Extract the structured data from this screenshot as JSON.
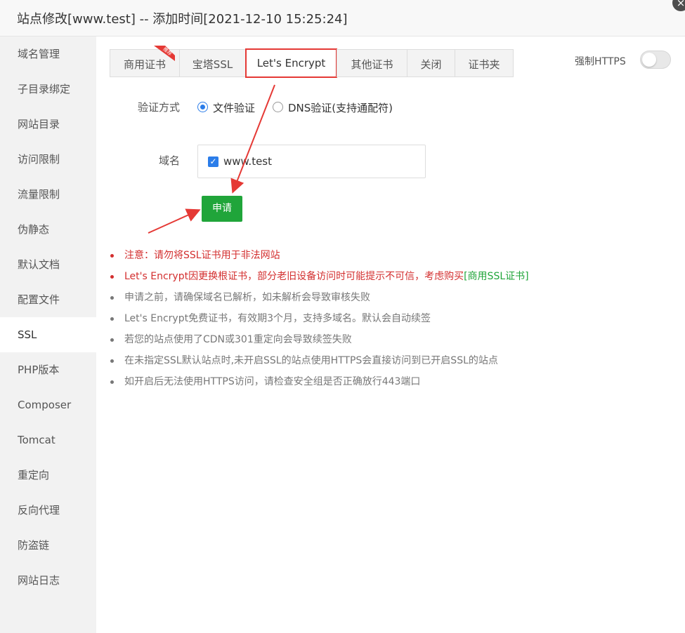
{
  "window": {
    "title": "站点修改[www.test] -- 添加时间[2021-12-10 15:25:24]",
    "close_glyph": "×"
  },
  "sidebar": {
    "items": [
      {
        "label": "域名管理"
      },
      {
        "label": "子目录绑定"
      },
      {
        "label": "网站目录"
      },
      {
        "label": "访问限制"
      },
      {
        "label": "流量限制"
      },
      {
        "label": "伪静态"
      },
      {
        "label": "默认文档"
      },
      {
        "label": "配置文件"
      },
      {
        "label": "SSL"
      },
      {
        "label": "PHP版本"
      },
      {
        "label": "Composer"
      },
      {
        "label": "Tomcat"
      },
      {
        "label": "重定向"
      },
      {
        "label": "反向代理"
      },
      {
        "label": "防盗链"
      },
      {
        "label": "网站日志"
      }
    ],
    "active": "SSL"
  },
  "tabs": {
    "items": [
      {
        "label": "商用证书",
        "badge": "推荐"
      },
      {
        "label": "宝塔SSL"
      },
      {
        "label": "Let's Encrypt"
      },
      {
        "label": "其他证书"
      },
      {
        "label": "关闭"
      },
      {
        "label": "证书夹"
      }
    ],
    "active": "Let's Encrypt"
  },
  "force_https": {
    "label": "强制HTTPS",
    "enabled": false
  },
  "form": {
    "verify_label": "验证方式",
    "verify_options": [
      {
        "label": "文件验证",
        "checked": true
      },
      {
        "label": "DNS验证(支持通配符)",
        "checked": false
      }
    ],
    "domain_label": "域名",
    "domain_value": "www.test",
    "domain_checked": true,
    "apply_button": "申请"
  },
  "notes": {
    "n0": "注意：请勿将SSL证书用于非法网站",
    "n1_text": "Let's Encrypt因更换根证书，部分老旧设备访问时可能提示不可信，考虑购买",
    "n1_link": "[商用SSL证书]",
    "n2": "申请之前，请确保域名已解析，如未解析会导致审核失败",
    "n3": "Let's Encrypt免费证书，有效期3个月，支持多域名。默认会自动续签",
    "n4": "若您的站点使用了CDN或301重定向会导致续签失败",
    "n5": "在未指定SSL默认站点时,未开启SSL的站点使用HTTPS会直接访问到已开启SSL的站点",
    "n6": "如开启后无法使用HTTPS访问，请检查安全组是否正确放行443端口"
  },
  "colors": {
    "accent_green": "#20a53a",
    "warning_red": "#d32f2f",
    "highlight_red": "#e53935",
    "radio_blue": "#2b7de9"
  }
}
